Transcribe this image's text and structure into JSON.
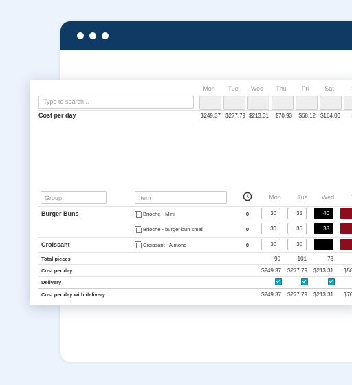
{
  "days": [
    "Mon",
    "Tue",
    "Wed",
    "Thu",
    "Fri",
    "Sat",
    "S"
  ],
  "search": {
    "placeholder": "Type to search..."
  },
  "summary": {
    "label": "Cost per day",
    "values": [
      "$249.37",
      "$277.79",
      "$213.31",
      "$70.93",
      "$68.12",
      "$164.00",
      "$"
    ]
  },
  "filters": {
    "group_placeholder": "Group",
    "item_placeholder": "Item"
  },
  "grid_days": [
    "Mon",
    "Tue",
    "Wed",
    "T"
  ],
  "groups": [
    {
      "name": "Burger Buns",
      "items": [
        {
          "name": "Brioche - Mini",
          "count": "0",
          "values": [
            "30",
            "35",
            "40",
            ""
          ]
        },
        {
          "name": "Brioche - burger bun small",
          "count": "0",
          "values": [
            "30",
            "36",
            "38",
            "4"
          ]
        }
      ]
    },
    {
      "name": "Croissant",
      "items": [
        {
          "name": "Croissant - Almond",
          "count": "0",
          "values": [
            "30",
            "30",
            "",
            ""
          ]
        }
      ]
    }
  ],
  "totals": {
    "total_pieces": {
      "label": "Total pieces",
      "values": [
        "90",
        "101",
        "78"
      ]
    },
    "cost_per_day": {
      "label": "Cost per day",
      "values": [
        "$249.37",
        "$277.79",
        "$213.31",
        "$58"
      ]
    },
    "delivery": {
      "label": "Delivery",
      "checked": [
        true,
        true,
        true
      ]
    },
    "cost_with_delivery": {
      "label": "Cost per day with delivery",
      "values": [
        "$249.37",
        "$277.79",
        "$213.31",
        "$70"
      ]
    }
  },
  "colors": {
    "header": "#0f3a63",
    "dark_cell": "#000000",
    "red_cell": "#8b0d1e",
    "checkbox": "#12a4b8",
    "background": "#edf3fd"
  },
  "icons": {
    "clock": "clock-icon",
    "trash": "trash-icon"
  }
}
